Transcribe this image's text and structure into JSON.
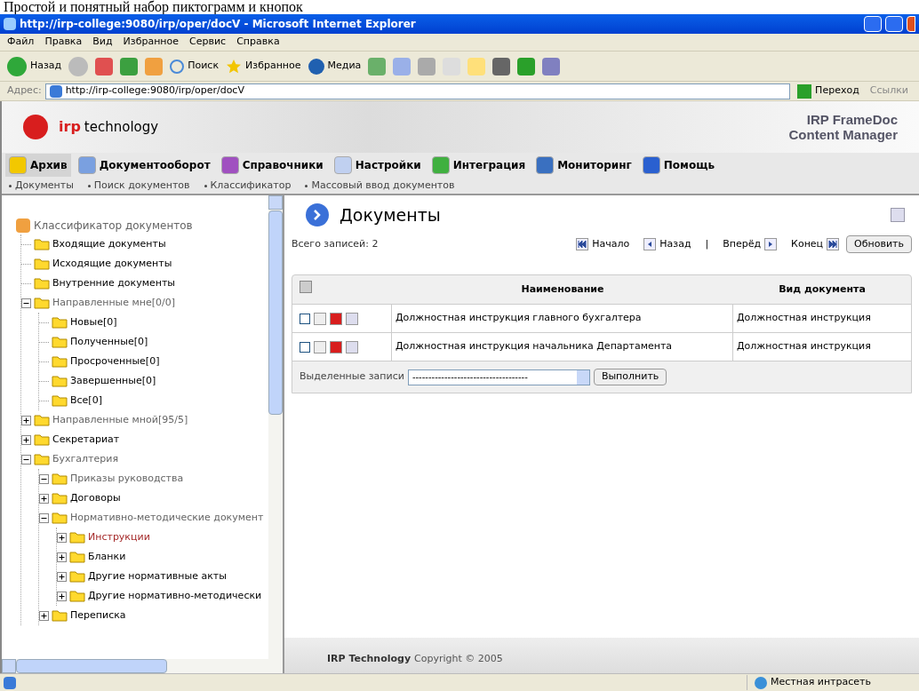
{
  "caption": "Простой и понятный набор пиктограмм и кнопок",
  "window": {
    "title": "http://irp-college:9080/irp/oper/docV - Microsoft Internet Explorer"
  },
  "menu": [
    "Файл",
    "Правка",
    "Вид",
    "Избранное",
    "Сервис",
    "Справка"
  ],
  "toolbar": {
    "back": "Назад",
    "search": "Поиск",
    "favorites": "Избранное",
    "media": "Медиа"
  },
  "address": {
    "label": "Адрес:",
    "value": "http://irp-college:9080/irp/oper/docV",
    "go": "Переход",
    "links": "Ссылки"
  },
  "banner": {
    "logo": "technology",
    "logo_mark": "irp",
    "product": "IRP FrameDoc",
    "product_line2": "Content Manager"
  },
  "nav": [
    {
      "label": "Архив",
      "selected": true
    },
    {
      "label": "Документооборот",
      "selected": false
    },
    {
      "label": "Справочники",
      "selected": false
    },
    {
      "label": "Настройки",
      "selected": false
    },
    {
      "label": "Интеграция",
      "selected": false
    },
    {
      "label": "Мониторинг",
      "selected": false
    },
    {
      "label": "Помощь",
      "selected": false
    }
  ],
  "subnav": [
    "Документы",
    "Поиск документов",
    "Классификатор",
    "Массовый ввод документов"
  ],
  "tree": {
    "root": "Классификатор документов",
    "items": [
      {
        "label": "Входящие документы",
        "expandable": false,
        "expanded": false,
        "muted": false,
        "selected": false
      },
      {
        "label": "Исходящие документы",
        "expandable": false,
        "expanded": false,
        "muted": false,
        "selected": false
      },
      {
        "label": "Внутренние документы",
        "expandable": false,
        "expanded": false,
        "muted": false,
        "selected": false
      },
      {
        "label": "Направленные мне[0/0]",
        "expandable": true,
        "expanded": true,
        "muted": true,
        "selected": false,
        "children": [
          {
            "label": "Новые[0]",
            "expandable": false,
            "expanded": false,
            "muted": false,
            "selected": false
          },
          {
            "label": "Полученные[0]",
            "expandable": false,
            "expanded": false,
            "muted": false,
            "selected": false
          },
          {
            "label": "Просроченные[0]",
            "expandable": false,
            "expanded": false,
            "muted": false,
            "selected": false
          },
          {
            "label": "Завершенные[0]",
            "expandable": false,
            "expanded": false,
            "muted": false,
            "selected": false
          },
          {
            "label": "Все[0]",
            "expandable": false,
            "expanded": false,
            "muted": false,
            "selected": false
          }
        ]
      },
      {
        "label": "Направленные мной[95/5]",
        "expandable": true,
        "expanded": false,
        "muted": true,
        "selected": false
      },
      {
        "label": "Секретариат",
        "expandable": true,
        "expanded": false,
        "muted": false,
        "selected": false
      },
      {
        "label": "Бухгалтерия",
        "expandable": true,
        "expanded": true,
        "muted": true,
        "selected": false,
        "children": [
          {
            "label": "Приказы руководства",
            "expandable": true,
            "expanded": true,
            "muted": true,
            "selected": false
          },
          {
            "label": "Договоры",
            "expandable": true,
            "expanded": false,
            "muted": false,
            "selected": false
          },
          {
            "label": "Нормативно-методические документ",
            "expandable": true,
            "expanded": true,
            "muted": true,
            "selected": false,
            "children": [
              {
                "label": "Инструкции",
                "expandable": true,
                "expanded": false,
                "muted": false,
                "selected": true
              },
              {
                "label": "Бланки",
                "expandable": true,
                "expanded": false,
                "muted": false,
                "selected": false
              },
              {
                "label": "Другие нормативные акты",
                "expandable": true,
                "expanded": false,
                "muted": false,
                "selected": false
              },
              {
                "label": "Другие нормативно-методически",
                "expandable": true,
                "expanded": false,
                "muted": false,
                "selected": false
              }
            ]
          },
          {
            "label": "Переписка",
            "expandable": true,
            "expanded": false,
            "muted": false,
            "selected": false
          }
        ]
      }
    ]
  },
  "content": {
    "title": "Документы",
    "total": "Всего записей: 2",
    "pager": {
      "first": "Начало",
      "prev": "Назад",
      "separator": "|",
      "next": "Вперёд",
      "last": "Конец",
      "refresh": "Обновить"
    },
    "table": {
      "columns": [
        "Наименование",
        "Вид документа"
      ],
      "rows": [
        {
          "checked": false,
          "name": "Должностная инструкция главного бухгалтера",
          "type": "Должностная инструкция"
        },
        {
          "checked": false,
          "name": "Должностная инструкция начальника Департамента",
          "type": "Должностная инструкция"
        }
      ]
    },
    "bulk": {
      "label": "Выделенные записи",
      "select": "------------------------------------",
      "run": "Выполнить"
    },
    "footer": {
      "brand": "IRP Technology",
      "copyright": "Copyright © 2005"
    }
  },
  "status_bar": {
    "zone": "Местная интрасеть"
  }
}
